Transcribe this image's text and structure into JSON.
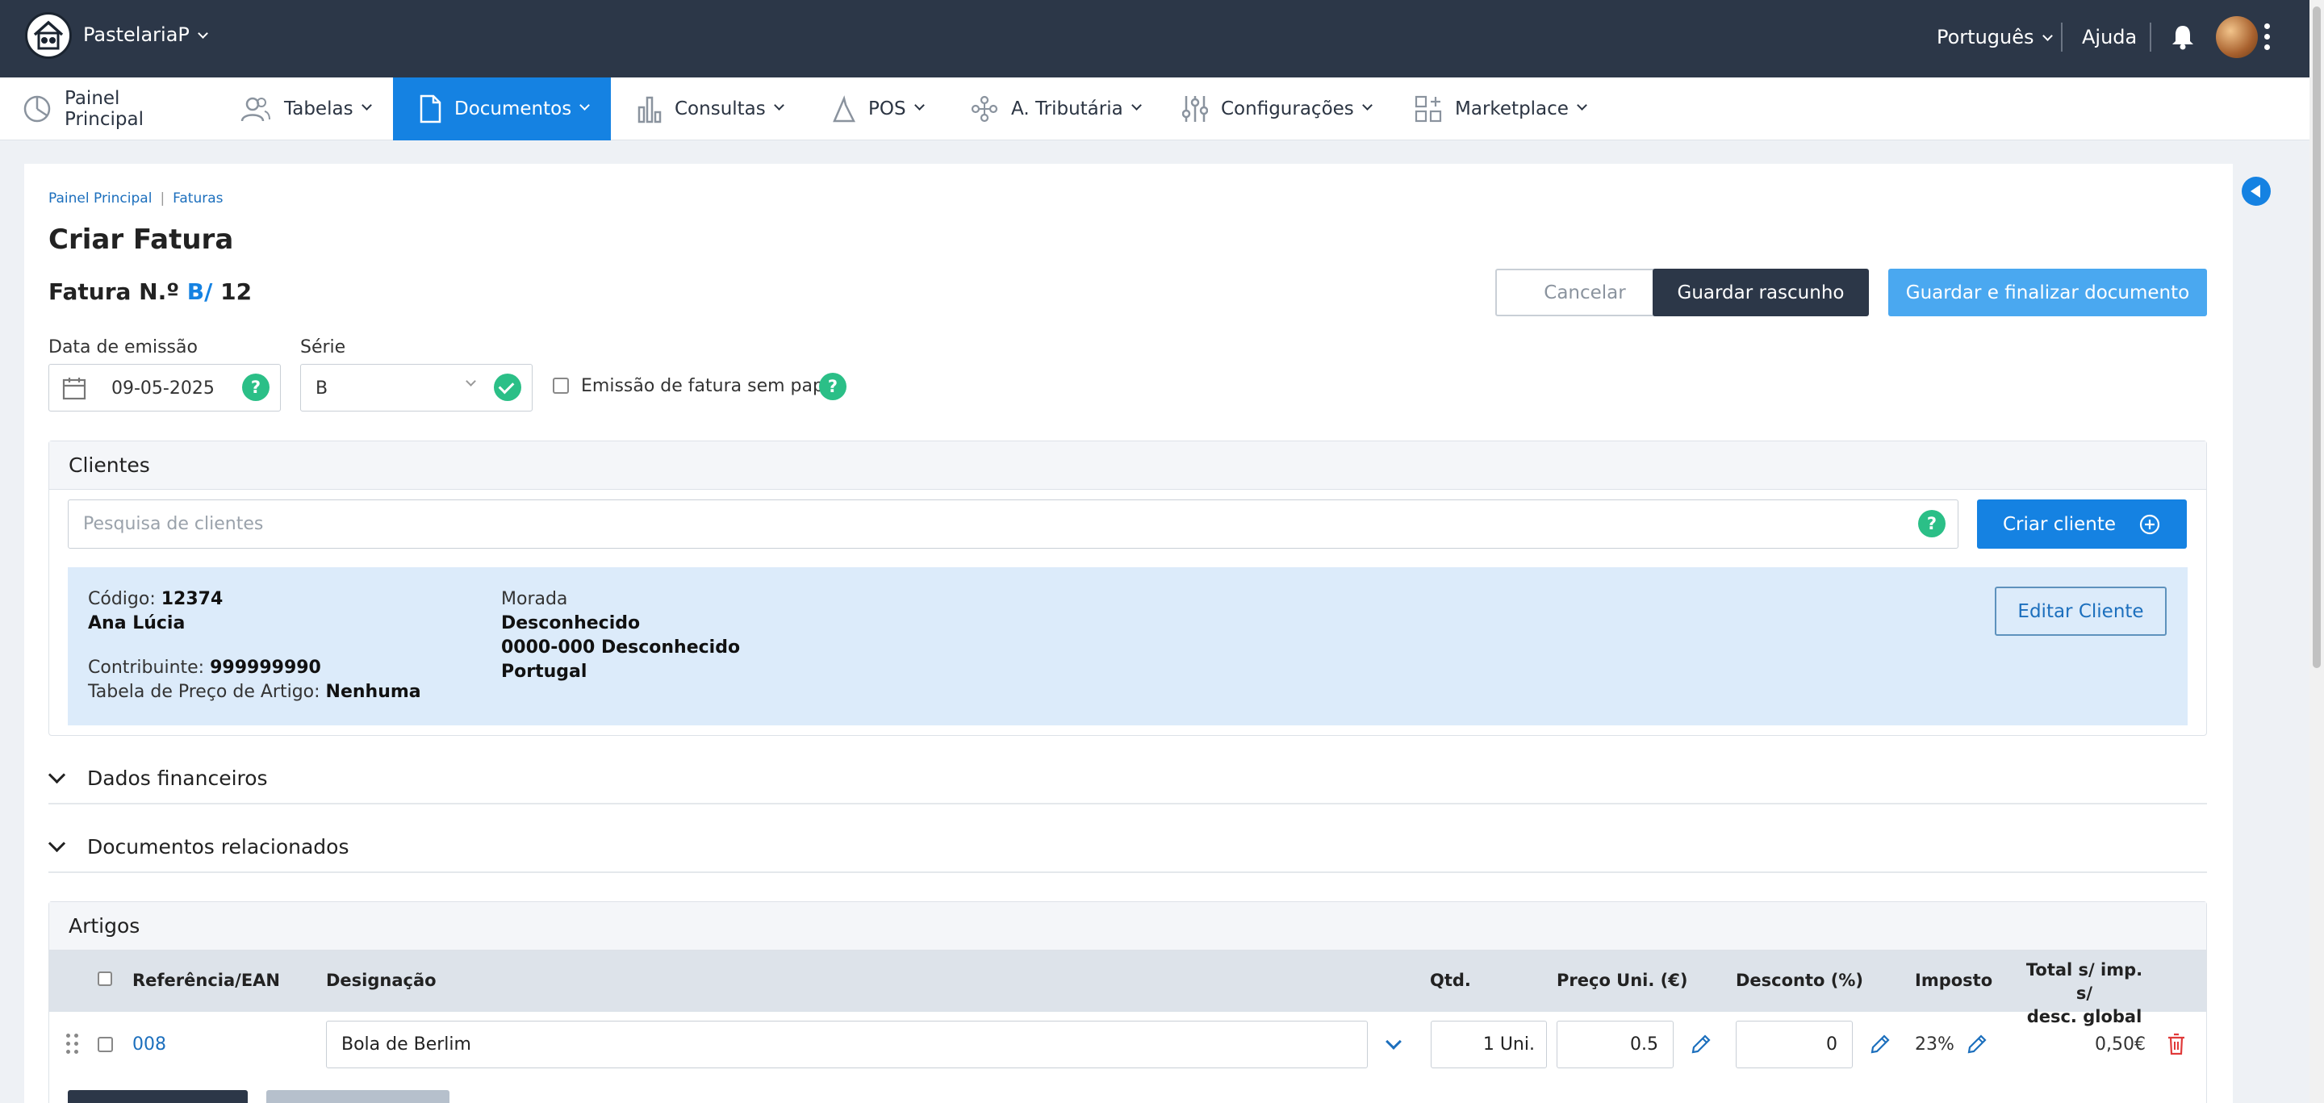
{
  "topbar": {
    "company": "PastelariaP",
    "language": "Português",
    "help": "Ajuda"
  },
  "nav": {
    "items": [
      {
        "label": "Painel Principal"
      },
      {
        "label": "Tabelas"
      },
      {
        "label": "Documentos"
      },
      {
        "label": "Consultas"
      },
      {
        "label": "POS"
      },
      {
        "label": "A. Tributária"
      },
      {
        "label": "Configurações"
      },
      {
        "label": "Marketplace"
      }
    ],
    "active": "Documentos"
  },
  "breadcrumb": {
    "home": "Painel Principal",
    "current": "Faturas"
  },
  "page": {
    "title": "Criar Fatura",
    "doc_prefix": "Fatura N.º",
    "doc_series": "B/",
    "doc_number": "12",
    "cancel_label": "Cancelar",
    "draft_label": "Guardar rascunho",
    "finalize_label": "Guardar e finalizar documento"
  },
  "form": {
    "date_label": "Data de emissão",
    "date_value": "09-05-2025",
    "series_label": "Série",
    "series_value": "B",
    "paperless_label": "Emissão de fatura sem papel"
  },
  "clients": {
    "title": "Clientes",
    "search_placeholder": "Pesquisa de clientes",
    "create_label": "Criar cliente",
    "edit_label": "Editar Cliente",
    "code_label": "Código:",
    "code": "12374",
    "name": "Ana Lúcia",
    "tax_label": "Contribuinte:",
    "tax_id": "999999990",
    "price_table_label": "Tabela de Preço de Artigo:",
    "price_table": "Nenhuma",
    "address_label": "Morada",
    "address_line1": "Desconhecido",
    "address_line2": "0000-000 Desconhecido",
    "country": "Portugal"
  },
  "sections": {
    "financial": "Dados financeiros",
    "related": "Documentos relacionados"
  },
  "articles": {
    "title": "Artigos",
    "columns": {
      "ref": "Referência/EAN",
      "designation": "Designação",
      "qty": "Qtd.",
      "unit_price": "Preço Uni. (€)",
      "discount": "Desconto (%)",
      "tax": "Imposto",
      "total_line1": "Total s/ imp. s/",
      "total_line2": "desc. global"
    },
    "rows": [
      {
        "ref": "008",
        "designation": "Bola de Berlim",
        "qty": "1 Uni.",
        "price": "0.5",
        "discount": "0",
        "tax": "23%",
        "total": "0,50€"
      }
    ]
  },
  "colors": {
    "topbar": "#2c3748",
    "accent": "#1582e2",
    "success": "#2bbf87",
    "client_box": "#dcebfa"
  }
}
